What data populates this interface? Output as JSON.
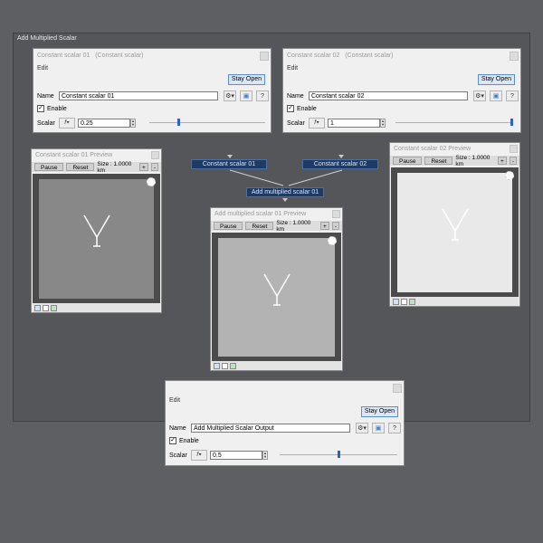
{
  "graph": {
    "title": "Add Multiplied Scalar"
  },
  "panel1": {
    "title": "Constant scalar 01",
    "subtitle": "(Constant scalar)",
    "menu_edit": "Edit",
    "stay_open": "Stay Open",
    "name_label": "Name",
    "name_value": "Constant scalar 01",
    "enable_label": "Enable",
    "enable_checked": true,
    "scalar_label": "Scalar",
    "scalar_value": "0.25",
    "slider_fraction": 0.25,
    "help": "?",
    "check": "✓"
  },
  "panel2": {
    "title": "Constant scalar 02",
    "subtitle": "(Constant scalar)",
    "menu_edit": "Edit",
    "stay_open": "Stay Open",
    "name_label": "Name",
    "name_value": "Constant scalar 02",
    "enable_label": "Enable",
    "enable_checked": true,
    "scalar_label": "Scalar",
    "scalar_value": "1",
    "slider_fraction": 1.0,
    "help": "?",
    "check": "✓"
  },
  "panel3": {
    "menu_edit": "Edit",
    "stay_open": "Stay Open",
    "name_label": "Name",
    "name_value": "Add Multiplied Scalar Output",
    "enable_label": "Enable",
    "enable_checked": true,
    "scalar_label": "Scalar",
    "scalar_value": "0.5",
    "slider_fraction": 0.5,
    "help": "?",
    "check": "✓"
  },
  "preview1": {
    "title": "Constant scalar 01 Preview",
    "pause": "Pause",
    "reset": "Reset",
    "size": "Size : 1.0000 km",
    "plus": "+",
    "minus": "-",
    "canvas_color": "#888888"
  },
  "preview2": {
    "title": "Constant scalar 02 Preview",
    "pause": "Pause",
    "reset": "Reset",
    "size": "Size : 1.0000 km",
    "plus": "+",
    "minus": "-",
    "canvas_color": "#e9e9e9"
  },
  "preview3": {
    "title": "Add multiplied scalar 01 Preview",
    "pause": "Pause",
    "reset": "Reset",
    "size": "Size : 1.0000 km",
    "plus": "+",
    "minus": "-",
    "canvas_color": "#b3b3b3"
  },
  "nodes": {
    "const1": "Constant scalar 01",
    "const2": "Constant scalar 02",
    "add": "Add multiplied scalar 01"
  },
  "icons": {
    "name_settings": "gear-dropdown-icon",
    "color": "image-icon",
    "help": "help-icon",
    "mode": "scalar-mode-icon"
  }
}
